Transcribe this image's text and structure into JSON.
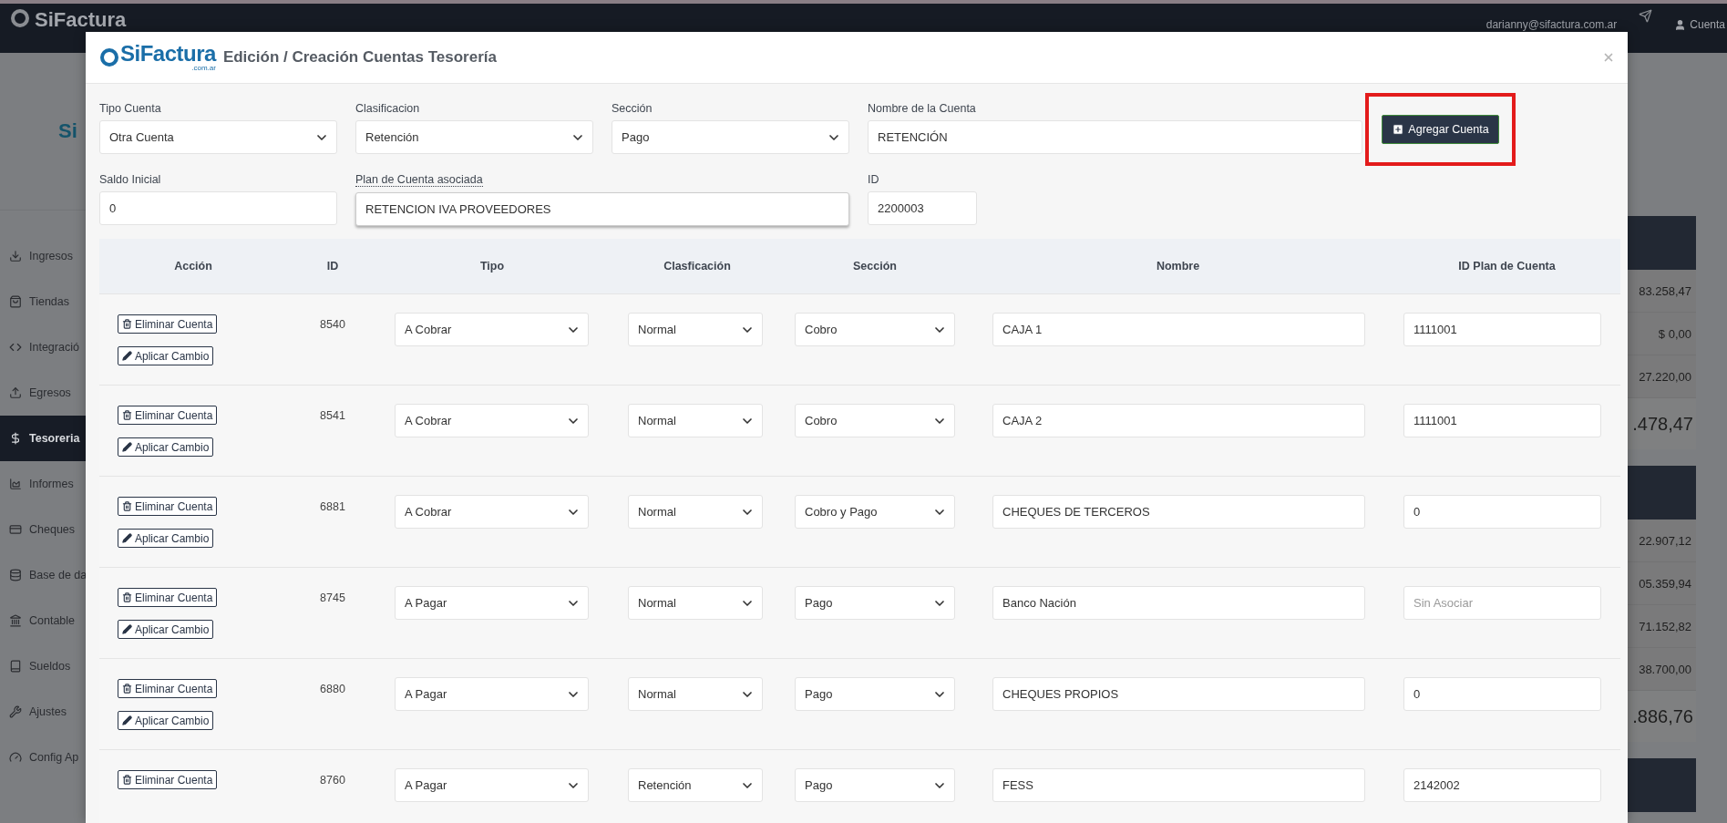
{
  "navbar": {
    "logo": "SiFactura",
    "user_email": "darianny@sifactura.com.ar",
    "account": "Cuenta"
  },
  "sidebar": {
    "logo_fragment": "Si",
    "items": [
      {
        "label": "Ingresos",
        "selected": false
      },
      {
        "label": "Tiendas",
        "selected": false
      },
      {
        "label": "Integració",
        "selected": false
      },
      {
        "label": "Egresos",
        "selected": false
      },
      {
        "label": "Tesoreria",
        "selected": true
      },
      {
        "label": "Informes",
        "selected": false
      },
      {
        "label": "Cheques",
        "selected": false
      },
      {
        "label": "Base de da",
        "selected": false
      },
      {
        "label": "Contable",
        "selected": false
      },
      {
        "label": "Sueldos",
        "selected": false
      },
      {
        "label": "Ajustes",
        "selected": false
      },
      {
        "label": "Config Ap",
        "selected": false
      }
    ]
  },
  "summary_cards": [
    {
      "rows": [
        "83.258,47",
        "$ 0,00",
        "27.220,00"
      ],
      "total": ".478,47"
    },
    {
      "rows": [
        "22.907,12",
        "05.359,94",
        "71.152,82",
        "38.700,00"
      ],
      "total": ".886,76"
    }
  ],
  "modal": {
    "logo": "SiFactura",
    "logo_sub": ".com.ar",
    "title": "Edición / Creación Cuentas Tesorería",
    "form": [
      {
        "kind": "select",
        "label": "Tipo Cuenta",
        "value": "Otra Cuenta"
      },
      {
        "kind": "select",
        "label": "Clasificacion",
        "value": "Retención"
      },
      {
        "kind": "select",
        "label": "Sección",
        "value": "Pago"
      },
      {
        "kind": "input",
        "label": "Nombre de la Cuenta",
        "value": "RETENCIÓN"
      },
      {
        "kind": "button",
        "label": "Agregar Cuenta",
        "highlighted": true
      },
      {
        "kind": "input",
        "label": "Saldo Inicial",
        "value": "0"
      },
      {
        "kind": "autocomplete",
        "label": "Plan de Cuenta asociada",
        "value": "RETENCION IVA PROVEEDORES"
      },
      {
        "kind": "id",
        "label": "ID",
        "value": "2200003"
      }
    ],
    "table": {
      "columns": [
        "Acción",
        "ID",
        "Tipo",
        "Clasficación",
        "Sección",
        "Nombre",
        "ID Plan de Cuenta"
      ],
      "rows": [
        {
          "actions": [
            {
              "kind": "delete",
              "label": "Eliminar Cuenta"
            },
            {
              "kind": "apply",
              "label": "Aplicar Cambio"
            }
          ],
          "id": "8540",
          "tipo": "A Cobrar",
          "clasificacion": "Normal",
          "seccion": "Cobro",
          "nombre": "CAJA 1",
          "plan": {
            "value": "1111001"
          }
        },
        {
          "actions": [
            {
              "kind": "delete",
              "label": "Eliminar Cuenta"
            },
            {
              "kind": "apply",
              "label": "Aplicar Cambio"
            }
          ],
          "id": "8541",
          "tipo": "A Cobrar",
          "clasificacion": "Normal",
          "seccion": "Cobro",
          "nombre": "CAJA 2",
          "plan": {
            "value": "1111001"
          }
        },
        {
          "actions": [
            {
              "kind": "delete",
              "label": "Eliminar Cuenta"
            },
            {
              "kind": "apply",
              "label": "Aplicar Cambio"
            }
          ],
          "id": "6881",
          "tipo": "A Cobrar",
          "clasificacion": "Normal",
          "seccion": "Cobro y Pago",
          "nombre": "CHEQUES DE TERCEROS",
          "plan": {
            "value": "0"
          }
        },
        {
          "actions": [
            {
              "kind": "delete",
              "label": "Eliminar Cuenta"
            },
            {
              "kind": "apply",
              "label": "Aplicar Cambio"
            }
          ],
          "id": "8745",
          "tipo": "A Pagar",
          "clasificacion": "Normal",
          "seccion": "Pago",
          "nombre": "Banco Nación",
          "plan": {
            "placeholder": "Sin Asociar"
          }
        },
        {
          "actions": [
            {
              "kind": "delete",
              "label": "Eliminar Cuenta"
            },
            {
              "kind": "apply",
              "label": "Aplicar Cambio"
            }
          ],
          "id": "6880",
          "tipo": "A Pagar",
          "clasificacion": "Normal",
          "seccion": "Pago",
          "nombre": "CHEQUES PROPIOS",
          "plan": {
            "value": "0"
          }
        },
        {
          "actions": [
            {
              "kind": "delete",
              "label": "Eliminar Cuenta"
            }
          ],
          "id": "8760",
          "tipo": "A Pagar",
          "clasificacion": "Retención",
          "seccion": "Pago",
          "nombre": "FESS",
          "plan": {
            "value": "2142002"
          }
        }
      ]
    }
  }
}
